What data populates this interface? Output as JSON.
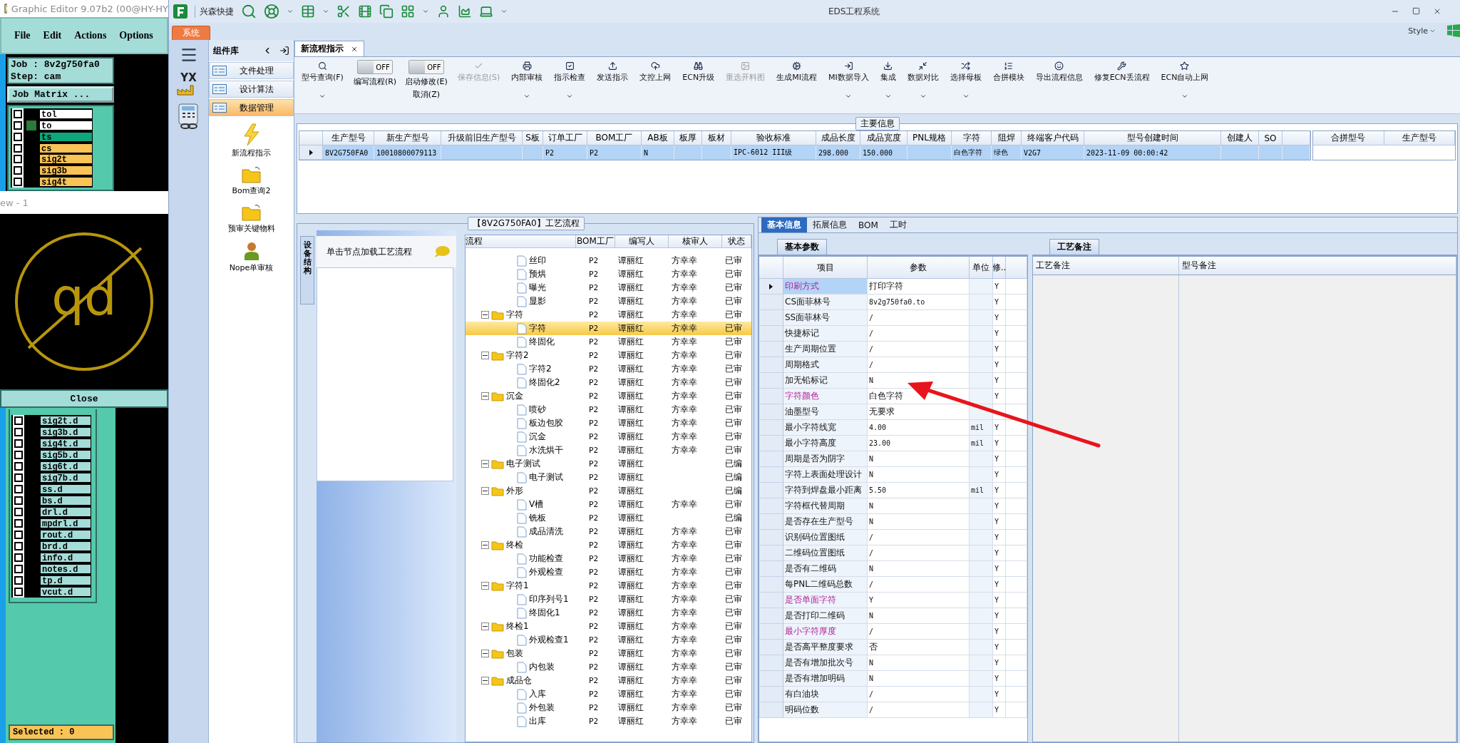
{
  "graphic_editor": {
    "title": "Graphic Editor 9.07b2 (00@HY-HY",
    "menu": [
      "File",
      "Edit",
      "Actions",
      "Options"
    ],
    "job": "Job : 8v2g750fa0",
    "step": "Step: cam",
    "matrix_button": "Job Matrix ...",
    "layers": [
      {
        "name": "tol",
        "checked": false,
        "marked": false,
        "color": "#ffffff"
      },
      {
        "name": "to",
        "checked": false,
        "marked": true,
        "color": "#ffffff"
      },
      {
        "name": "ts",
        "checked": false,
        "marked": false,
        "color": "#0fa67a"
      },
      {
        "name": "cs",
        "checked": false,
        "marked": false,
        "color": "#fac356"
      },
      {
        "name": "sig2t",
        "checked": false,
        "marked": false,
        "color": "#fac356"
      },
      {
        "name": "sig3b",
        "checked": false,
        "marked": false,
        "color": "#fac356"
      },
      {
        "name": "sig4t",
        "checked": false,
        "marked": false,
        "color": "#fac356"
      }
    ],
    "overlay_title": "ew - 1",
    "canvas_text": "qd",
    "close_button": "Close",
    "layers_d": [
      {
        "name": "sig2t.d",
        "checked": false
      },
      {
        "name": "sig3b.d",
        "checked": false
      },
      {
        "name": "sig4t.d",
        "checked": false
      },
      {
        "name": "sig5b.d",
        "checked": false
      },
      {
        "name": "sig6t.d",
        "checked": false
      },
      {
        "name": "sig7b.d",
        "checked": false
      },
      {
        "name": "ss.d",
        "checked": false
      },
      {
        "name": "bs.d",
        "checked": false
      },
      {
        "name": "drl.d",
        "checked": false
      },
      {
        "name": "mpdrl.d",
        "checked": false
      },
      {
        "name": "rout.d",
        "checked": false
      },
      {
        "name": "brd.d",
        "checked": false
      },
      {
        "name": "info.d",
        "checked": false
      },
      {
        "name": "notes.d",
        "checked": false
      },
      {
        "name": "tp.d",
        "checked": false
      },
      {
        "name": "vcut.d",
        "checked": false
      }
    ],
    "selected_count": "Selected : 0"
  },
  "app": {
    "title": "EDS工程系统",
    "quick_access": "兴森快捷",
    "ribbon_tab": "系统",
    "style_menu": "Style"
  },
  "sidebar": {
    "logo_text": "YX",
    "title": "组件库",
    "groups": [
      {
        "label": "文件处理",
        "selected": false
      },
      {
        "label": "设计算法",
        "selected": false
      },
      {
        "label": "数据管理",
        "selected": true
      }
    ],
    "items": [
      {
        "label": "新流程指示",
        "kind": "action"
      },
      {
        "label": "Bom查询2",
        "kind": "folder"
      },
      {
        "label": "预审关键物料",
        "kind": "folder"
      },
      {
        "label": "Nope单审核",
        "kind": "user"
      }
    ]
  },
  "document_tabs": [
    {
      "label": "新流程指示",
      "selected": true
    }
  ],
  "toolbar": [
    {
      "kind": "button",
      "label": "型号查询(F)",
      "dropdown": true,
      "disabled": false
    },
    {
      "kind": "toggle",
      "state_text": "OFF",
      "on": false,
      "label": "编写流程(R)"
    },
    {
      "kind": "toggle",
      "state_text": "OFF",
      "on": false,
      "label": "启动修改(E)",
      "second_label": "取消(Z)"
    },
    {
      "kind": "button",
      "label": "保存信息(S)",
      "dropdown": false,
      "disabled": true
    },
    {
      "kind": "button",
      "label": "内部审核",
      "dropdown": true,
      "disabled": false
    },
    {
      "kind": "button",
      "label": "指示检查",
      "dropdown": true,
      "disabled": false
    },
    {
      "kind": "button",
      "label": "发送指示",
      "dropdown": false,
      "disabled": false
    },
    {
      "kind": "button",
      "label": "文控上网",
      "dropdown": false,
      "disabled": false
    },
    {
      "kind": "button",
      "label": "ECN升级",
      "dropdown": false,
      "disabled": false
    },
    {
      "kind": "button",
      "label": "重选开料图",
      "dropdown": false,
      "disabled": true
    },
    {
      "kind": "button",
      "label": "生成MI流程",
      "dropdown": false,
      "disabled": false
    },
    {
      "kind": "button",
      "label": "MI数据导入",
      "dropdown": true,
      "disabled": false
    },
    {
      "kind": "button",
      "label": "集成",
      "dropdown": true,
      "disabled": false
    },
    {
      "kind": "button",
      "label": "数据对比",
      "dropdown": true,
      "disabled": false
    },
    {
      "kind": "button",
      "label": "选择母板",
      "dropdown": true,
      "disabled": false
    },
    {
      "kind": "button",
      "label": "合拼模块",
      "dropdown": false,
      "disabled": false
    },
    {
      "kind": "button",
      "label": "导出流程信息",
      "dropdown": false,
      "disabled": false
    },
    {
      "kind": "button",
      "label": "修复ECN丢流程",
      "dropdown": false,
      "disabled": false
    },
    {
      "kind": "button",
      "label": "ECN自动上网",
      "dropdown": true,
      "disabled": false
    }
  ],
  "main_info": {
    "title": "主要信息",
    "columns": [
      "生产型号",
      "新生产型号",
      "升级前旧生产型号",
      "S板",
      "订单工厂",
      "BOM工厂",
      "AB板",
      "板厚",
      "板材",
      "验收标准",
      "成品长度",
      "成品宽度",
      "PNL规格",
      "字符",
      "阻焊",
      "终端客户代码",
      "型号创建时间",
      "创建人",
      "SO"
    ],
    "rows": [
      {
        "selected": true,
        "cells": [
          "8V2G750FA0",
          "10010800079113",
          null,
          null,
          "P2",
          "P2",
          "N",
          null,
          null,
          "IPC-6012 III级",
          "298.000",
          "150.000",
          null,
          "白色字符",
          "绿色",
          "V2G7",
          "2023-11-09 00:00:42",
          null,
          null
        ]
      }
    ],
    "merge_columns": [
      "合拼型号",
      "生产型号"
    ]
  },
  "process_panel": {
    "title": "【8V2G750FA0】工艺流程",
    "side_tab": "设备结构",
    "hint": "单击节点加载工艺流程",
    "columns": [
      "流程",
      "BOM工厂",
      "编写人",
      "核审人",
      "状态"
    ],
    "tree": [
      {
        "children": [
          {
            "label": "丝印",
            "bom": "P2",
            "author": "谭丽红",
            "reviewer": "方幸幸",
            "status": "已审",
            "selected": false
          },
          {
            "label": "预烘",
            "bom": "P2",
            "author": "谭丽红",
            "reviewer": "方幸幸",
            "status": "已审",
            "selected": false
          },
          {
            "label": "曝光",
            "bom": "P2",
            "author": "谭丽红",
            "reviewer": "方幸幸",
            "status": "已审",
            "selected": false
          },
          {
            "label": "显影",
            "bom": "P2",
            "author": "谭丽红",
            "reviewer": "方幸幸",
            "status": "已审",
            "selected": false
          }
        ]
      },
      {
        "label": "字符",
        "bom": "P2",
        "author": "谭丽红",
        "reviewer": "方幸幸",
        "status": "已审",
        "selected": false,
        "expanded": true,
        "children": [
          {
            "label": "字符",
            "bom": "P2",
            "author": "谭丽红",
            "reviewer": "方幸幸",
            "status": "已审",
            "selected": true
          },
          {
            "label": "终固化",
            "bom": "P2",
            "author": "谭丽红",
            "reviewer": "方幸幸",
            "status": "已审",
            "selected": false
          }
        ]
      },
      {
        "label": "字符2",
        "bom": "P2",
        "author": "谭丽红",
        "reviewer": "方幸幸",
        "status": "已审",
        "selected": false,
        "expanded": true,
        "children": [
          {
            "label": "字符2",
            "bom": "P2",
            "author": "谭丽红",
            "reviewer": "方幸幸",
            "status": "已审",
            "selected": false
          },
          {
            "label": "终固化2",
            "bom": "P2",
            "author": "谭丽红",
            "reviewer": "方幸幸",
            "status": "已审",
            "selected": false
          }
        ]
      },
      {
        "label": "沉金",
        "bom": "P2",
        "author": "谭丽红",
        "reviewer": "方幸幸",
        "status": "已审",
        "selected": false,
        "expanded": true,
        "children": [
          {
            "label": "喷砂",
            "bom": "P2",
            "author": "谭丽红",
            "reviewer": "方幸幸",
            "status": "已审",
            "selected": false
          },
          {
            "label": "板边包胶",
            "bom": "P2",
            "author": "谭丽红",
            "reviewer": "方幸幸",
            "status": "已审",
            "selected": false
          },
          {
            "label": "沉金",
            "bom": "P2",
            "author": "谭丽红",
            "reviewer": "方幸幸",
            "status": "已审",
            "selected": false
          },
          {
            "label": "水洗烘干",
            "bom": "P2",
            "author": "谭丽红",
            "reviewer": "方幸幸",
            "status": "已审",
            "selected": false
          }
        ]
      },
      {
        "label": "电子测试",
        "bom": "P2",
        "author": "谭丽红",
        "status": "已编",
        "selected": false,
        "expanded": true,
        "children": [
          {
            "label": "电子测试",
            "bom": "P2",
            "author": "谭丽红",
            "status": "已编",
            "selected": false
          }
        ]
      },
      {
        "label": "外形",
        "bom": "P2",
        "author": "谭丽红",
        "status": "已编",
        "selected": false,
        "expanded": true,
        "children": [
          {
            "label": "V槽",
            "bom": "P2",
            "author": "谭丽红",
            "reviewer": "方幸幸",
            "status": "已审",
            "selected": false
          },
          {
            "label": "铣板",
            "bom": "P2",
            "author": "谭丽红",
            "status": "已编",
            "selected": false
          },
          {
            "label": "成品清洗",
            "bom": "P2",
            "author": "谭丽红",
            "reviewer": "方幸幸",
            "status": "已审",
            "selected": false
          }
        ]
      },
      {
        "label": "终检",
        "bom": "P2",
        "author": "谭丽红",
        "reviewer": "方幸幸",
        "status": "已审",
        "selected": false,
        "expanded": true,
        "children": [
          {
            "label": "功能检查",
            "bom": "P2",
            "author": "谭丽红",
            "reviewer": "方幸幸",
            "status": "已审",
            "selected": false
          },
          {
            "label": "外观检查",
            "bom": "P2",
            "author": "谭丽红",
            "reviewer": "方幸幸",
            "status": "已审",
            "selected": false
          }
        ]
      },
      {
        "label": "字符1",
        "bom": "P2",
        "author": "谭丽红",
        "reviewer": "方幸幸",
        "status": "已审",
        "selected": false,
        "expanded": true,
        "children": [
          {
            "label": "印序列号1",
            "bom": "P2",
            "author": "谭丽红",
            "reviewer": "方幸幸",
            "status": "已审",
            "selected": false
          },
          {
            "label": "终固化1",
            "bom": "P2",
            "author": "谭丽红",
            "reviewer": "方幸幸",
            "status": "已审",
            "selected": false
          }
        ]
      },
      {
        "label": "终检1",
        "bom": "P2",
        "author": "谭丽红",
        "reviewer": "方幸幸",
        "status": "已审",
        "selected": false,
        "expanded": true,
        "children": [
          {
            "label": "外观检查1",
            "bom": "P2",
            "author": "谭丽红",
            "reviewer": "方幸幸",
            "status": "已审",
            "selected": false
          }
        ]
      },
      {
        "label": "包装",
        "bom": "P2",
        "author": "谭丽红",
        "reviewer": "方幸幸",
        "status": "已审",
        "selected": false,
        "expanded": true,
        "children": [
          {
            "label": "内包装",
            "bom": "P2",
            "author": "谭丽红",
            "reviewer": "方幸幸",
            "status": "已审",
            "selected": false
          }
        ]
      },
      {
        "label": "成品仓",
        "bom": "P2",
        "author": "谭丽红",
        "reviewer": "方幸幸",
        "status": "已审",
        "selected": false,
        "expanded": true,
        "children": [
          {
            "label": "入库",
            "bom": "P2",
            "author": "谭丽红",
            "reviewer": "方幸幸",
            "status": "已审",
            "selected": false
          },
          {
            "label": "外包装",
            "bom": "P2",
            "author": "谭丽红",
            "reviewer": "方幸幸",
            "status": "已审",
            "selected": false
          },
          {
            "label": "出库",
            "bom": "P2",
            "author": "谭丽红",
            "reviewer": "方幸幸",
            "status": "已审",
            "selected": false
          }
        ]
      }
    ]
  },
  "detail_tabs": [
    {
      "label": "基本信息",
      "selected": true
    },
    {
      "label": "拓展信息",
      "selected": false
    },
    {
      "label": "BOM",
      "selected": false
    },
    {
      "label": "工时",
      "selected": false
    }
  ],
  "params": {
    "tab": "基本参数",
    "columns": [
      "项目",
      "参数",
      "单位",
      "修.."
    ],
    "rows": [
      {
        "item": "印刷方式",
        "value": "打印字符",
        "flag": "Y",
        "highlight": true,
        "selected": true
      },
      {
        "item": "CS面菲林号",
        "value": "8v2g750fa0.to",
        "flag": "Y",
        "highlight": false,
        "selected": false
      },
      {
        "item": "SS面菲林号",
        "value": "/",
        "flag": "Y",
        "highlight": false,
        "selected": false
      },
      {
        "item": "快捷标记",
        "value": "/",
        "flag": "Y",
        "highlight": false,
        "selected": false
      },
      {
        "item": "生产周期位置",
        "value": "/",
        "flag": "Y",
        "highlight": false,
        "selected": false
      },
      {
        "item": "周期格式",
        "value": "/",
        "flag": "Y",
        "highlight": false,
        "selected": false
      },
      {
        "item": "加无铅标记",
        "value": "N",
        "flag": "Y",
        "highlight": false,
        "selected": false
      },
      {
        "item": "字符颜色",
        "value": "白色字符",
        "flag": "Y",
        "highlight": true,
        "selected": false
      },
      {
        "item": "油墨型号",
        "value": "无要求",
        "highlight": false,
        "selected": false
      },
      {
        "item": "最小字符线宽",
        "value": "4.00",
        "unit": "mil",
        "flag": "Y",
        "highlight": false,
        "selected": false
      },
      {
        "item": "最小字符高度",
        "value": "23.00",
        "unit": "mil",
        "flag": "Y",
        "highlight": false,
        "selected": false
      },
      {
        "item": "周期是否为阴字",
        "value": "N",
        "flag": "Y",
        "highlight": false,
        "selected": false
      },
      {
        "item": "字符上表面处理设计",
        "value": "N",
        "flag": "Y",
        "highlight": false,
        "selected": false
      },
      {
        "item": "字符到焊盘最小距离",
        "value": "5.50",
        "unit": "mil",
        "flag": "Y",
        "highlight": false,
        "selected": false
      },
      {
        "item": "字符框代替周期",
        "value": "N",
        "flag": "Y",
        "highlight": false,
        "selected": false
      },
      {
        "item": "是否存在生产型号",
        "value": "N",
        "flag": "Y",
        "highlight": false,
        "selected": false
      },
      {
        "item": "识别码位置图纸",
        "value": "/",
        "flag": "Y",
        "highlight": false,
        "selected": false
      },
      {
        "item": "二维码位置图纸",
        "value": "/",
        "flag": "Y",
        "highlight": false,
        "selected": false
      },
      {
        "item": "是否有二维码",
        "value": "N",
        "flag": "Y",
        "highlight": false,
        "selected": false
      },
      {
        "item": "每PNL二维码总数",
        "value": "/",
        "flag": "Y",
        "highlight": false,
        "selected": false
      },
      {
        "item": "是否单面字符",
        "value": "Y",
        "flag": "Y",
        "highlight": true,
        "selected": false
      },
      {
        "item": "是否打印二维码",
        "value": "N",
        "flag": "Y",
        "highlight": false,
        "selected": false
      },
      {
        "item": "最小字符厚度",
        "value": "/",
        "flag": "Y",
        "highlight": true,
        "selected": false
      },
      {
        "item": "是否高平整度要求",
        "value": "否",
        "flag": "Y",
        "highlight": false,
        "selected": false
      },
      {
        "item": "是否有增加批次号",
        "value": "N",
        "flag": "Y",
        "highlight": false,
        "selected": false
      },
      {
        "item": "是否有增加明码",
        "value": "N",
        "flag": "Y",
        "highlight": false,
        "selected": false
      },
      {
        "item": "有白油块",
        "value": "/",
        "flag": "Y",
        "highlight": false,
        "selected": false
      },
      {
        "item": "明码位数",
        "value": "/",
        "flag": "Y",
        "highlight": false,
        "selected": false
      }
    ]
  },
  "notes": {
    "tab": "工艺备注",
    "columns": [
      "工艺备注",
      "型号备注"
    ]
  }
}
